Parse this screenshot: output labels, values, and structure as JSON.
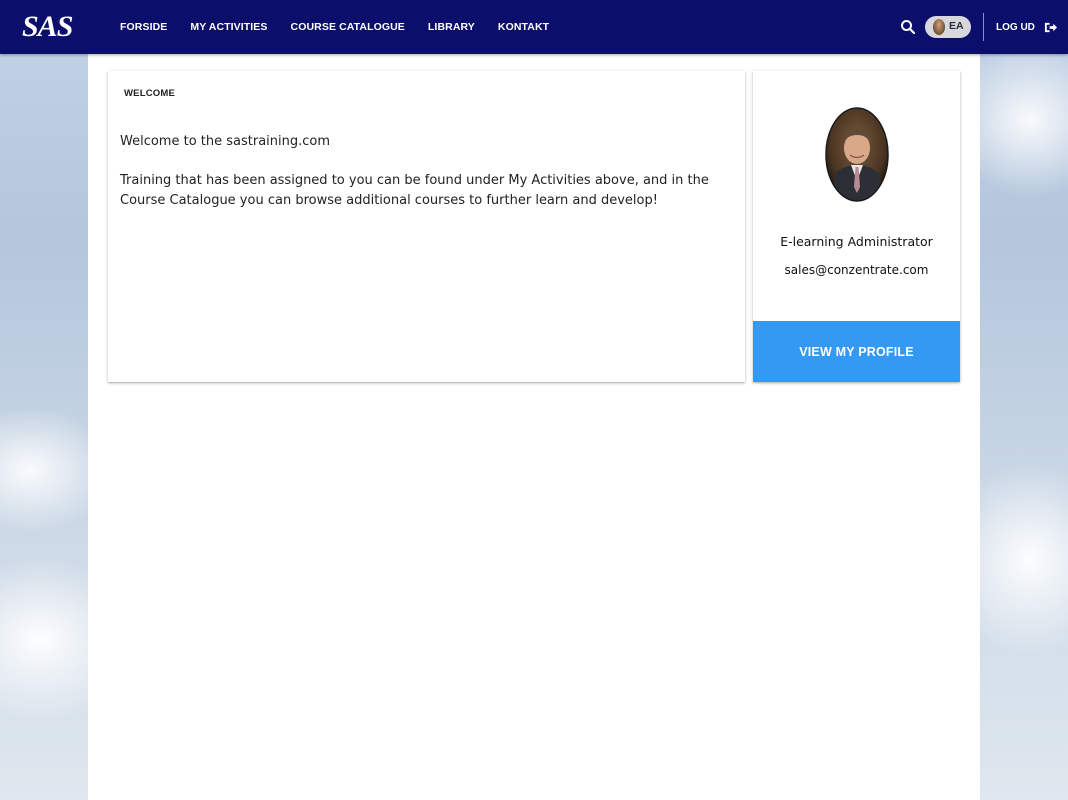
{
  "header": {
    "logo_text": "SAS",
    "nav": [
      {
        "label": "FORSIDE"
      },
      {
        "label": "MY ACTIVITIES"
      },
      {
        "label": "COURSE CATALOGUE"
      },
      {
        "label": "LIBRARY"
      },
      {
        "label": "KONTAKT"
      }
    ],
    "search_icon": "search-icon",
    "user_initials": "EA",
    "logout_label": "LOG UD",
    "logout_icon": "sign-out-icon",
    "colors": {
      "bar": "#0b0f6b",
      "text": "#ffffff"
    }
  },
  "welcome": {
    "title": "WELCOME",
    "paragraphs": [
      "Welcome to the sastraining.com",
      "Training that has been assigned to you can be found under My Activities above, and in the Course Catalogue you can browse additional courses to further learn and develop!"
    ]
  },
  "profile": {
    "name": "E-learning Administrator",
    "email": "sales@conzentrate.com",
    "button_label": "VIEW MY PROFILE",
    "button_color": "#3399f3"
  }
}
